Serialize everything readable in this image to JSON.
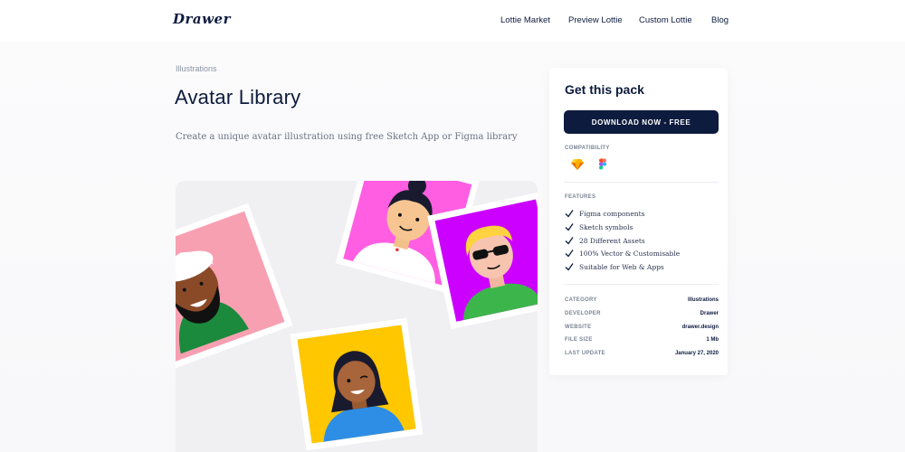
{
  "header": {
    "logo": "Drawer",
    "nav": [
      "Lottie Market",
      "Preview Lottie",
      "Custom Lottie",
      "Blog"
    ]
  },
  "main": {
    "breadcrumb": "Illustrations",
    "title": "Avatar Library",
    "description": "Create a unique avatar illustration using free Sketch App or Figma library"
  },
  "sidebar": {
    "title": "Get this pack",
    "download_label": "DOWNLOAD NOW - FREE",
    "compatibility_label": "COMPATIBILITY",
    "compatibility_icons": [
      "sketch-icon",
      "figma-icon"
    ],
    "features_label": "FEATURES",
    "features": [
      "Figma components",
      "Sketch symbols",
      "28 Different Assets",
      "100% Vector & Customisable",
      "Suitable for Web & Apps"
    ],
    "meta": [
      {
        "key": "CATEGORY",
        "value": "Illustrations"
      },
      {
        "key": "DEVELOPER",
        "value": "Drawer"
      },
      {
        "key": "WEBSITE",
        "value": "drawer.design"
      },
      {
        "key": "FILE SIZE",
        "value": "1 Mb"
      },
      {
        "key": "LAST UPDATE",
        "value": "January 27, 2020"
      }
    ]
  },
  "colors": {
    "navy": "#0d1b3e",
    "pink": "#f7a0b1",
    "magenta": "#ff5ee2",
    "purple": "#cc00ff",
    "yellow": "#ffc700"
  }
}
